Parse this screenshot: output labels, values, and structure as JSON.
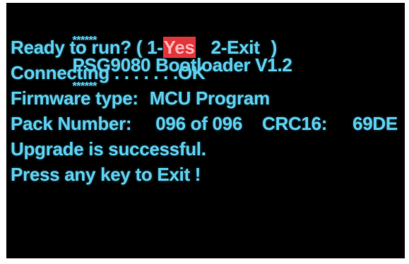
{
  "colors": {
    "text": "#5ccfee",
    "background": "#000000",
    "highlight": "#e2353a"
  },
  "title": {
    "left_stars": "******",
    "text": "PSG9080 Bootloader V1.2",
    "right_stars": "******"
  },
  "prompt": {
    "question": "Ready to run? ( 1-",
    "option_yes": "Yes",
    "option_exit": "2-Exit",
    "close": ")"
  },
  "connecting": {
    "label": "Connecting",
    "dots": ". . . . . .",
    "status": "OK"
  },
  "firmware": {
    "label": "Firmware type:",
    "value": "MCU Program"
  },
  "pack": {
    "label": "Pack Number:",
    "value": "096 of 096",
    "crc_label": "CRC16:",
    "crc_value": "69DE"
  },
  "result_message": "Upgrade is successful.",
  "exit_prompt": "Press any key to Exit !"
}
